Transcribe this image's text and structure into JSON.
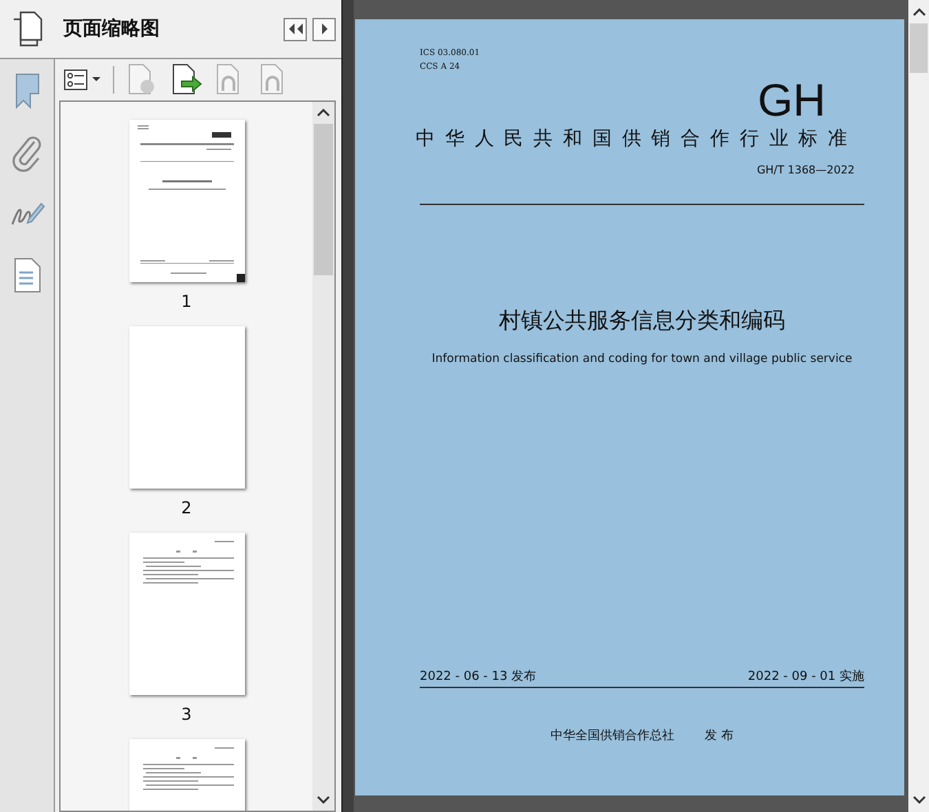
{
  "panel": {
    "title": "页面缩略图",
    "nav_buttons": [
      {
        "kind": "first"
      },
      {
        "kind": "next"
      }
    ]
  },
  "toolbar": [
    {
      "kind": "options",
      "disabled": false
    },
    {
      "kind": "delete",
      "disabled": true
    },
    {
      "kind": "insert",
      "disabled": false
    },
    {
      "kind": "rotate-left",
      "disabled": true
    },
    {
      "kind": "rotate-right",
      "disabled": true
    }
  ],
  "thumbnails": [
    {
      "kind": "cover",
      "label": "1",
      "current": true
    },
    {
      "kind": "blank",
      "label": "2",
      "current": false
    },
    {
      "kind": "text",
      "label": "3",
      "current": false
    },
    {
      "kind": "text"
    }
  ],
  "document": {
    "ics": "ICS  03.080.01",
    "ccs": "CCS  A 24",
    "logo": "GH",
    "org_title": "中华人民共和国供销合作行业标准",
    "standard_no": "GH/T 1368—2022",
    "title_cn": "村镇公共服务信息分类和编码",
    "title_en": "Information classification and coding for town and village public service",
    "publish_date": "2022 - 06 - 13 发布",
    "effective_date": "2022 - 09 - 01 实施",
    "publisher": "中华全国供销合作总社",
    "publisher_action": "发  布"
  }
}
